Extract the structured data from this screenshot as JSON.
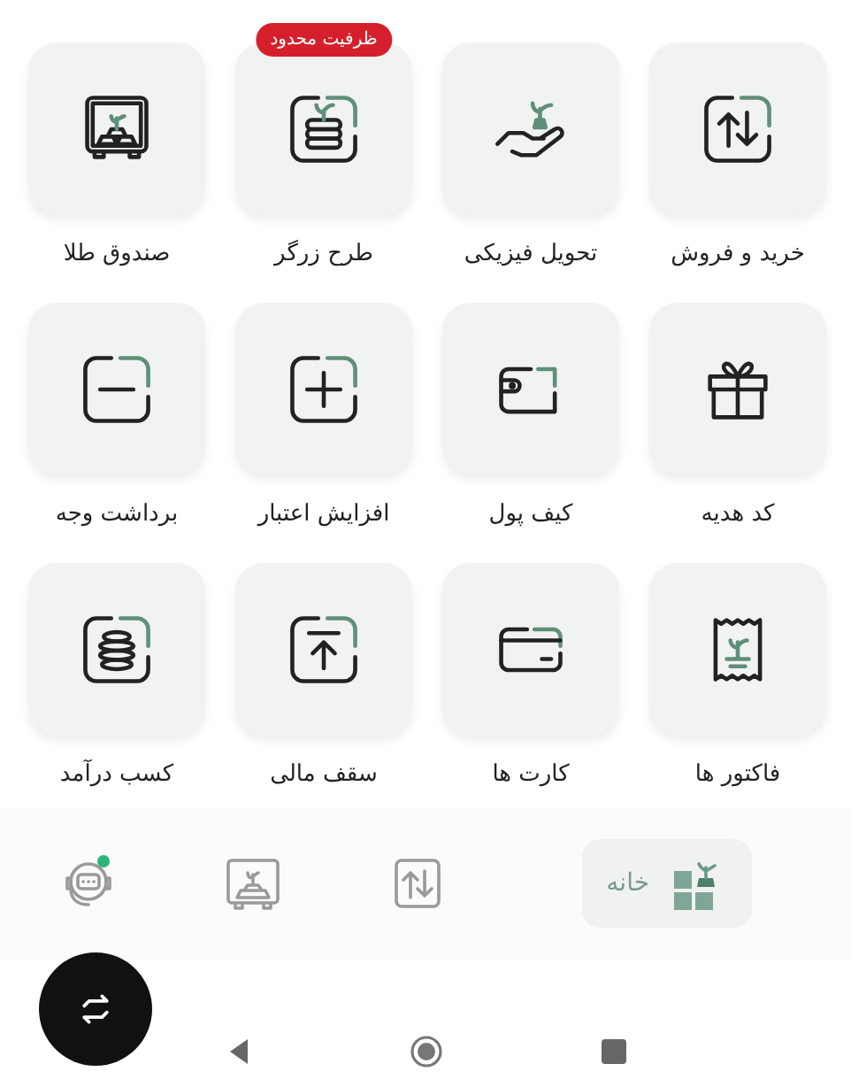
{
  "tiles": [
    {
      "label": "خرید و فروش"
    },
    {
      "label": "تحویل فیزیکی"
    },
    {
      "label": "طرح زرگر",
      "badge": "ظرفیت محدود"
    },
    {
      "label": "صندوق طلا"
    },
    {
      "label": "کد هدیه"
    },
    {
      "label": "کیف پول"
    },
    {
      "label": "افزایش اعتبار"
    },
    {
      "label": "برداشت وجه"
    },
    {
      "label": "فاکتور ها"
    },
    {
      "label": "کارت ها"
    },
    {
      "label": "سقف مالی"
    },
    {
      "label": "کسب درآمد"
    }
  ],
  "nav": [
    {
      "label": "خانه",
      "selected": true
    },
    {
      "selected": false
    },
    {
      "selected": false
    },
    {
      "selected": false,
      "notification": true
    }
  ]
}
